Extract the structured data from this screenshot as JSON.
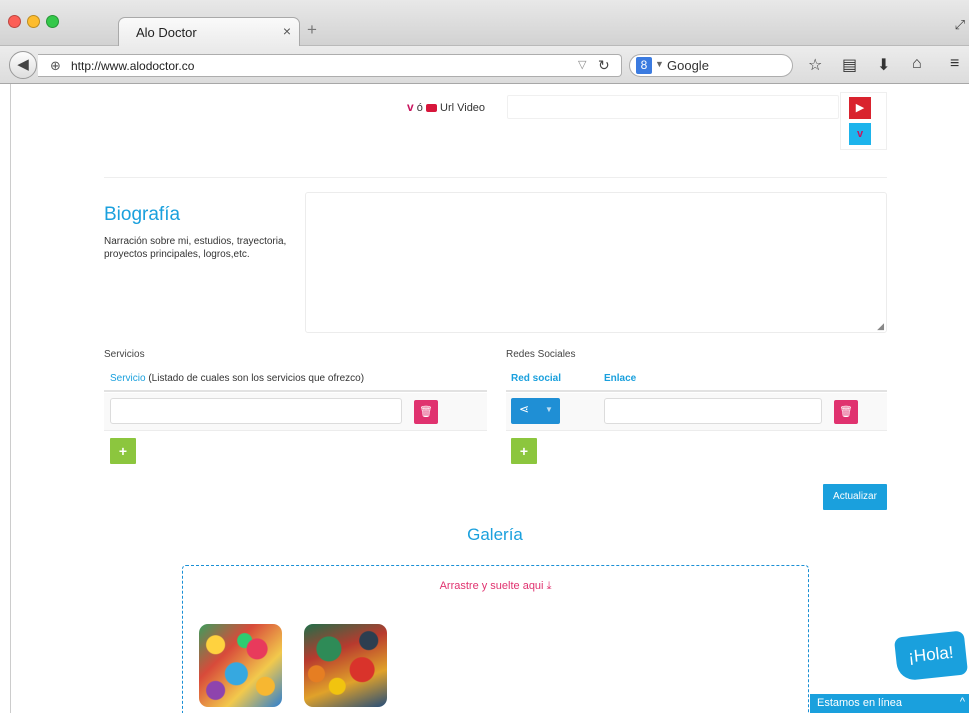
{
  "browser": {
    "tab_title": "Alo Doctor",
    "tab_close": "×",
    "new_tab": "+",
    "url": "http://www.alodoctor.co",
    "search_engine": "Google",
    "search_engine_glyph": "8"
  },
  "video": {
    "label_or": "ó",
    "label": "Url Video",
    "value": ""
  },
  "bio": {
    "title": "Biografía",
    "description": "Narración sobre mi, estudios, trayectoria, proyectos principales, logros,etc.",
    "value": ""
  },
  "services": {
    "title": "Servicios",
    "column_header_strong": "Servicio",
    "column_header_rest": " (Listado de cuales son los servicios que ofrezco)",
    "rows": [
      ""
    ]
  },
  "social": {
    "title": "Redes Sociales",
    "columns": [
      "Red social",
      "Enlace"
    ],
    "rows": [
      {
        "network": "",
        "link": ""
      }
    ]
  },
  "actions": {
    "update_label": "Actualizar",
    "add_label": "+"
  },
  "gallery": {
    "title": "Galería",
    "drop_text": "Arrastre y suelte aqui",
    "images": 2
  },
  "chat": {
    "bubble": "¡Hola!",
    "status": "Estamos en línea"
  },
  "colors": {
    "accent": "#1aa0dd",
    "danger": "#e0326f",
    "success": "#8cc63e",
    "youtube": "#d9232e",
    "vimeo": "#1db4ec"
  }
}
